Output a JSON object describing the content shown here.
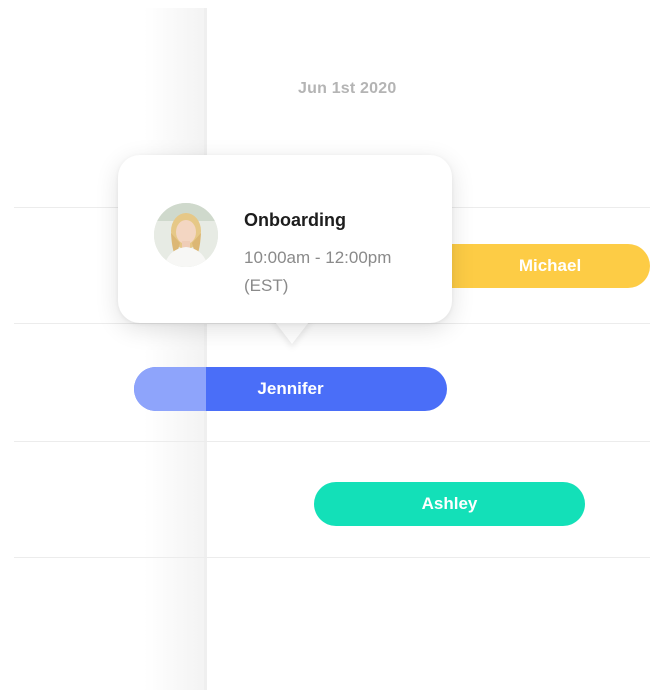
{
  "calendar": {
    "date_label": "Jun 1st 2020"
  },
  "events": {
    "michael": {
      "name": "Michael",
      "color": "#fdcc45"
    },
    "jennifer": {
      "name": "Jennifer",
      "color": "#4a6ef8"
    },
    "ashley": {
      "name": "Ashley",
      "color": "#13e0b8"
    }
  },
  "popover": {
    "title": "Onboarding",
    "time_range": "10:00am - 12:00pm",
    "timezone": "(EST)",
    "avatar_icon": "user-avatar-photo"
  }
}
